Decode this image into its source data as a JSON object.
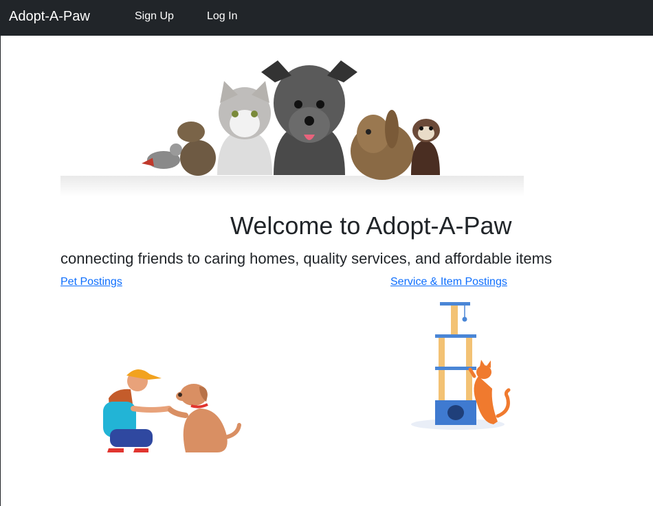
{
  "nav": {
    "brand": "Adopt-A-Paw",
    "signup_label": "Sign Up",
    "login_label": "Log In"
  },
  "main": {
    "title": "Welcome to Adopt-A-Paw",
    "tagline": "connecting friends to caring homes, quality services, and affordable items",
    "pet_link": "Pet Postings",
    "service_link": "Service & Item Postings"
  },
  "colors": {
    "navbar": "#212529",
    "link": "#0d6efd",
    "text": "#212529"
  },
  "images": {
    "hero": "pets-group-photo",
    "pet_illustration": "person-high-five-dog-illustration",
    "service_illustration": "cat-tree-with-cat-illustration"
  }
}
